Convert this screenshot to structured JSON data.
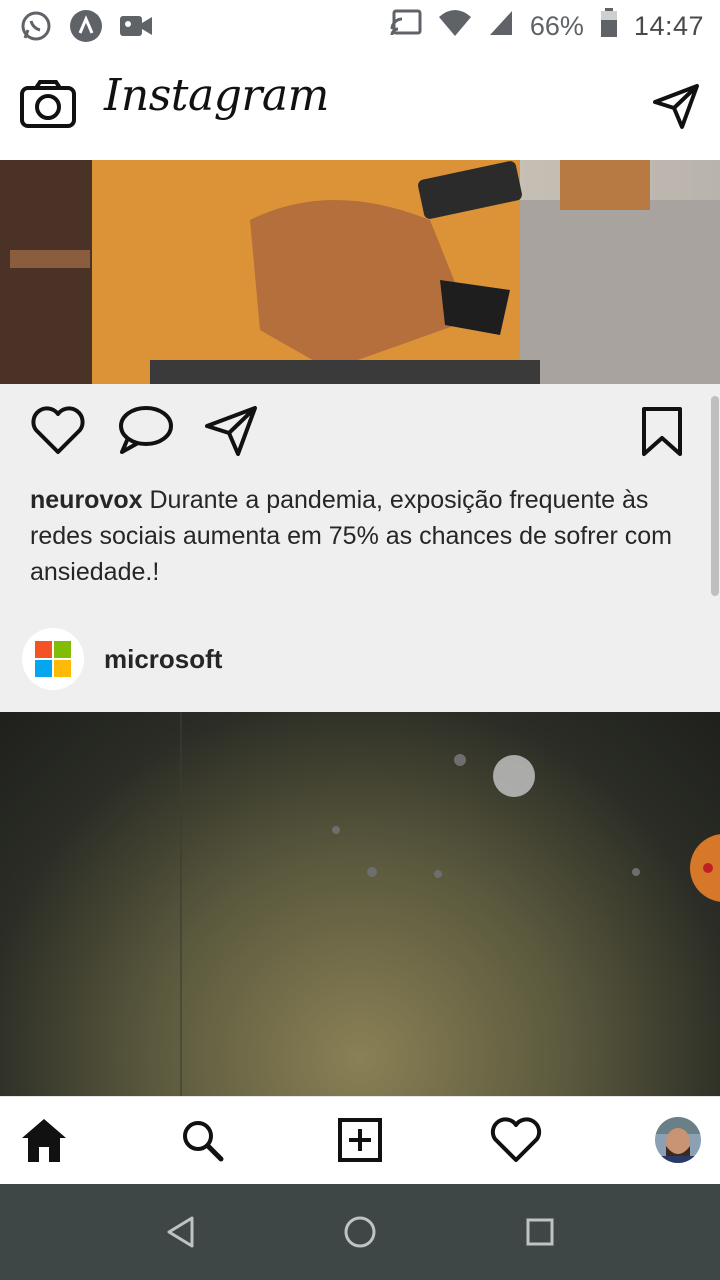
{
  "status_bar": {
    "battery": "66%",
    "time": "14:47",
    "left_icons": [
      "whatsapp-icon",
      "app-notification-icon",
      "video-camera-icon"
    ],
    "right_icons": [
      "cast-icon",
      "wifi-icon",
      "cellular-signal-icon",
      "battery-icon"
    ]
  },
  "header": {
    "logo": "Instagram",
    "camera_icon": "camera-icon",
    "direct_icon": "send-icon"
  },
  "post": {
    "username": "neurovox",
    "caption": "Durante a pandemia, exposição frequente às redes sociais aumenta em 75% as chances de sofrer com ansiedade.!",
    "actions": [
      "heart-icon",
      "comment-icon",
      "send-icon",
      "bookmark-icon"
    ]
  },
  "next_post": {
    "username": "microsoft"
  },
  "bottom_nav": [
    "home-icon",
    "search-icon",
    "add-post-icon",
    "activity-heart-icon",
    "profile-avatar"
  ],
  "android_nav": [
    "back-icon",
    "home-circle-icon",
    "recents-icon"
  ]
}
